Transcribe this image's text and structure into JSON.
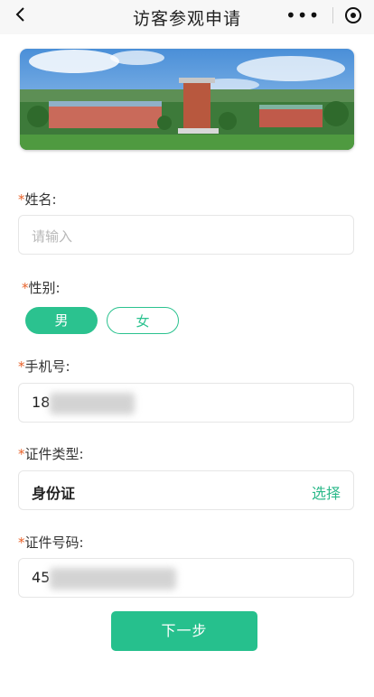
{
  "nav": {
    "title": "访客参观申请",
    "back_icon": "chevron-left-icon",
    "more_icon": "more-dots-icon",
    "close_icon": "target-circle-icon"
  },
  "form": {
    "name": {
      "label": "姓名:",
      "placeholder": "请输入"
    },
    "gender": {
      "label": "性别:",
      "options": [
        "男",
        "女"
      ],
      "selected": "男"
    },
    "phone": {
      "label": "手机号:",
      "value_visible": "18"
    },
    "id_type": {
      "label": "证件类型:",
      "value": "身份证",
      "action": "选择"
    },
    "id_number": {
      "label": "证件号码:",
      "value_visible": "45"
    },
    "required_mark": "*"
  },
  "footer": {
    "next_label": "下一步"
  },
  "colors": {
    "accent": "#26c08d",
    "required": "#e8622a"
  }
}
